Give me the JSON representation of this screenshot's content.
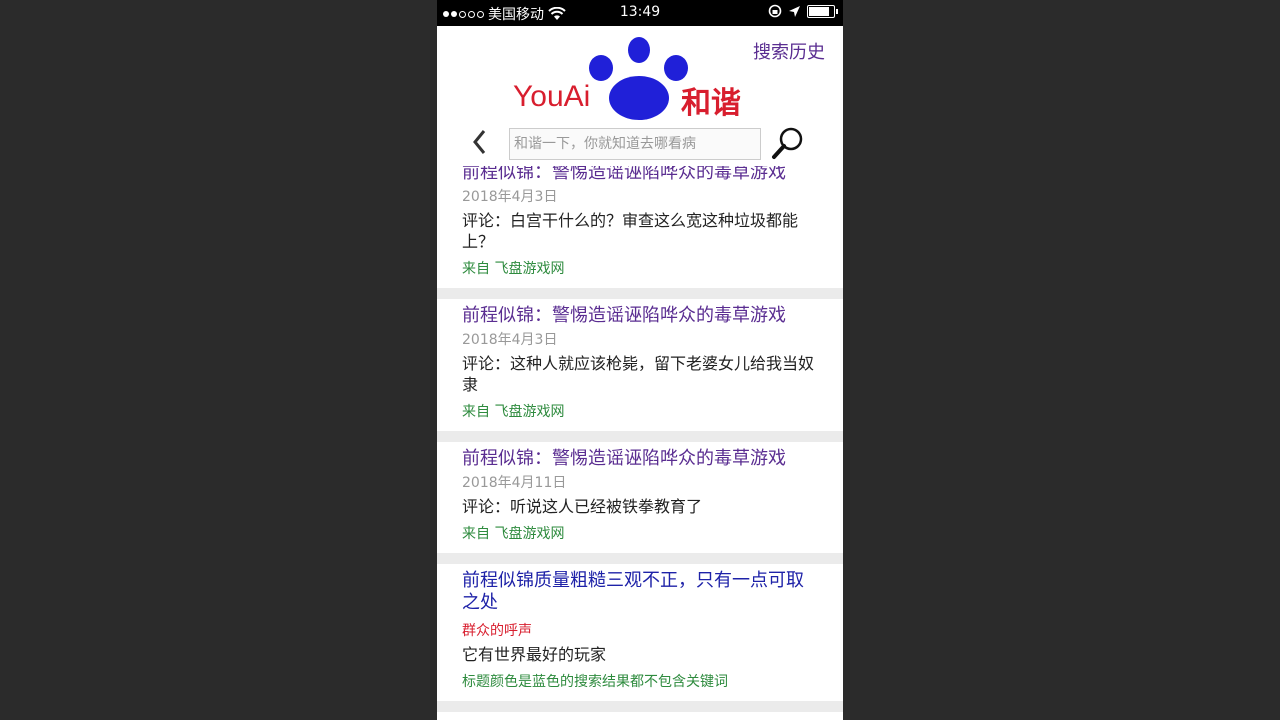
{
  "status_bar": {
    "carrier": "美国移动",
    "time": "13:49",
    "battery_level": 0.9
  },
  "header": {
    "history_link": "搜索历史",
    "logo_text": "YouAi",
    "logo_cn": "和谐",
    "search_placeholder": "和谐一下，你就知道去哪看病",
    "back_icon": "chevron-left-icon",
    "search_icon": "magnifier-icon"
  },
  "results": [
    {
      "title": "前程似锦：警惕造谣诬陷哗众的毒草游戏",
      "date": "2018年4月3日",
      "comment": "评论：白宫干什么的？审查这么宽这种垃圾都能上？",
      "source": "来自  飞盘游戏网"
    },
    {
      "title": "前程似锦：警惕造谣诬陷哗众的毒草游戏",
      "date": "2018年4月3日",
      "comment": "评论：这种人就应该枪毙，留下老婆女儿给我当奴隶",
      "source": "来自  飞盘游戏网"
    },
    {
      "title": "前程似锦：警惕造谣诬陷哗众的毒草游戏",
      "date": "2018年4月11日",
      "comment": "评论：听说这人已经被铁拳教育了",
      "source": "来自  飞盘游戏网"
    },
    {
      "title": "前程似锦质量粗糙三观不正，只有一点可取之处",
      "voice": "群众的呼声",
      "comment": "它有世界最好的玩家",
      "source": "标题颜色是蓝色的搜索结果都不包含关键词"
    }
  ],
  "colors": {
    "title_purple": "#5a2d91",
    "title_blue": "#1e22a8",
    "brand_red": "#d81e2e",
    "paw_blue": "#2020d8",
    "source_green": "#2e8b3e"
  }
}
